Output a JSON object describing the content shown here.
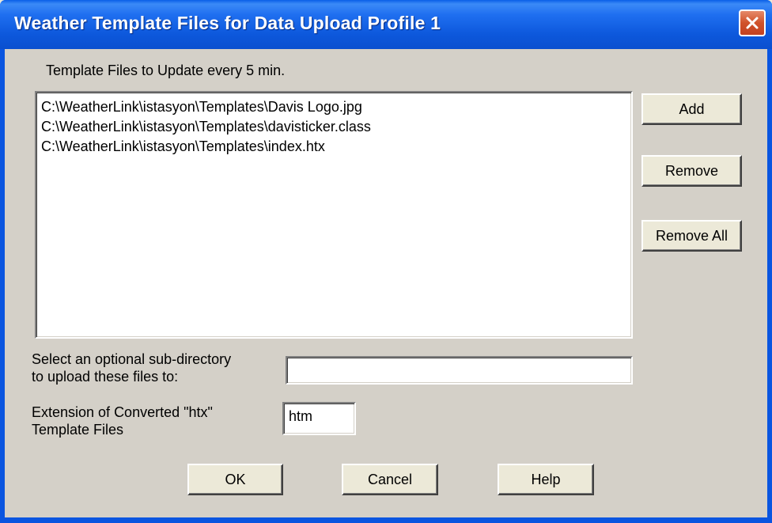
{
  "window": {
    "title": "Weather Template Files for Data Upload Profile 1"
  },
  "list": {
    "label": "Template Files to Update every 5 min.",
    "items": [
      "C:\\WeatherLink\\istasyon\\Templates\\Davis Logo.jpg",
      "C:\\WeatherLink\\istasyon\\Templates\\davisticker.class",
      "C:\\WeatherLink\\istasyon\\Templates\\index.htx"
    ]
  },
  "side_buttons": {
    "add_label": "Add",
    "remove_label": "Remove",
    "remove_all_label": "Remove All"
  },
  "subdirectory": {
    "label": "Select an optional sub-directory\nto upload these files to:",
    "value": ""
  },
  "extension": {
    "label": "Extension of Converted \"htx\"\nTemplate Files",
    "value": "htm"
  },
  "footer_buttons": {
    "ok_label": "OK",
    "cancel_label": "Cancel",
    "help_label": "Help"
  },
  "colors": {
    "titlebar": "#0a55e0",
    "client": "#d4d0c8",
    "close_button": "#d0522b"
  },
  "icons": {
    "close": "close-icon"
  }
}
